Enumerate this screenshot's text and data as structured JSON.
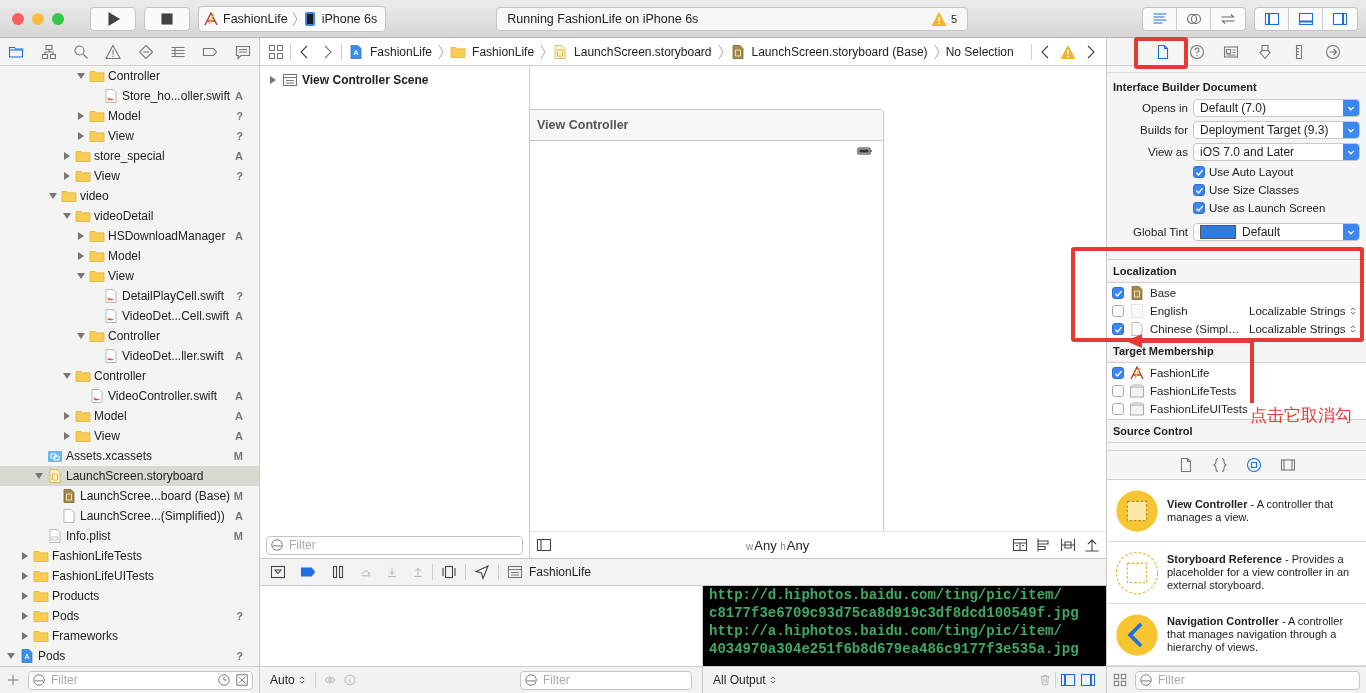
{
  "toolbar": {
    "scheme": "FashionLife",
    "device": "iPhone 6s",
    "activity": "Running FashionLife on iPhone 6s",
    "warnings": "5",
    "editor_modes": [
      {
        "kind": "standard",
        "selected": true
      },
      {
        "kind": "assistant",
        "selected": false
      },
      {
        "kind": "version",
        "selected": false
      }
    ],
    "panels": [
      {
        "kind": "panel_left",
        "on": true
      },
      {
        "kind": "panel_bottom",
        "on": true
      },
      {
        "kind": "panel_right",
        "on": true
      }
    ]
  },
  "navigator": {
    "tabs": [
      {
        "kind": "nav_folder",
        "selected": true
      },
      {
        "kind": "hierarchy",
        "selected": false
      },
      {
        "kind": "search",
        "selected": false
      },
      {
        "kind": "warning",
        "selected": false
      },
      {
        "kind": "diamond",
        "selected": false
      },
      {
        "kind": "list",
        "selected": false
      },
      {
        "kind": "tag",
        "selected": false
      },
      {
        "kind": "chat",
        "selected": false
      }
    ],
    "tree": [
      {
        "children": [
          {
            "children": [
              {
                "children": [
                  {
                    "children": [
                      {
                        "children": [
                          {
                            "label": "Controller",
                            "kind": "folder",
                            "expanded": true,
                            "selected": false,
                            "children": [
                              {
                                "label": "Store_ho...oller.swift",
                                "kind": "swift",
                                "selected": false,
                                "status": "A"
                              }
                            ]
                          },
                          {
                            "label": "Model",
                            "kind": "folder",
                            "expanded": false,
                            "selected": false,
                            "status": "?"
                          },
                          {
                            "label": "View",
                            "kind": "folder",
                            "expanded": false,
                            "selected": false,
                            "status": "?"
                          }
                        ]
                      },
                      {
                        "label": "store_special",
                        "kind": "folder",
                        "expanded": false,
                        "selected": false,
                        "status": "A"
                      },
                      {
                        "label": "View",
                        "kind": "folder",
                        "expanded": false,
                        "selected": false,
                        "status": "?"
                      }
                    ]
                  },
                  {
                    "label": "video",
                    "kind": "folder",
                    "expanded": true,
                    "selected": false,
                    "children": [
                      {
                        "label": "videoDetail",
                        "kind": "folder",
                        "expanded": true,
                        "selected": false,
                        "children": [
                          {
                            "label": "HSDownloadManager",
                            "kind": "folder",
                            "expanded": false,
                            "selected": false,
                            "status": "A"
                          },
                          {
                            "label": "Model",
                            "kind": "folder",
                            "expanded": false,
                            "selected": false
                          },
                          {
                            "label": "View",
                            "kind": "folder",
                            "expanded": true,
                            "selected": false,
                            "children": [
                              {
                                "label": "DetailPlayCell.swift",
                                "kind": "swift",
                                "selected": false,
                                "status": "?"
                              },
                              {
                                "label": "VideoDet...Cell.swift",
                                "kind": "swift",
                                "selected": false,
                                "status": "A"
                              }
                            ]
                          },
                          {
                            "label": "Controller",
                            "kind": "folder",
                            "expanded": true,
                            "selected": false,
                            "children": [
                              {
                                "label": "VideoDet...ller.swift",
                                "kind": "swift",
                                "selected": false,
                                "status": "A"
                              }
                            ]
                          }
                        ]
                      },
                      {
                        "label": "Controller",
                        "kind": "folder",
                        "expanded": true,
                        "selected": false,
                        "children": [
                          {
                            "label": "VideoController.swift",
                            "kind": "swift",
                            "selected": false,
                            "status": "A"
                          }
                        ]
                      },
                      {
                        "label": "Model",
                        "kind": "folder",
                        "expanded": false,
                        "selected": false,
                        "status": "A"
                      },
                      {
                        "label": "View",
                        "kind": "folder",
                        "expanded": false,
                        "selected": false,
                        "status": "A"
                      }
                    ]
                  }
                ]
              },
              {
                "label": "Assets.xcassets",
                "kind": "assets",
                "selected": false,
                "status": "M"
              },
              {
                "label": "LaunchScreen.storyboard",
                "kind": "storyboard",
                "expanded": true,
                "selected": true,
                "children": [
                  {
                    "label": "LaunchScree...board (Base)",
                    "kind": "storyboard_base",
                    "selected": false,
                    "status": "M"
                  },
                  {
                    "label": "LaunchScree...(Simplified))",
                    "kind": "strings",
                    "selected": false,
                    "status": "A"
                  }
                ]
              },
              {
                "label": "Info.plist",
                "kind": "plist",
                "selected": false,
                "status": "M"
              }
            ]
          },
          {
            "label": "FashionLifeTests",
            "kind": "folder",
            "expanded": false,
            "selected": false
          },
          {
            "label": "FashionLifeUITests",
            "kind": "folder",
            "expanded": false,
            "selected": false
          },
          {
            "label": "Products",
            "kind": "folder",
            "expanded": false,
            "selected": false
          },
          {
            "label": "Pods",
            "kind": "folder",
            "expanded": false,
            "selected": false,
            "status": "?"
          },
          {
            "label": "Frameworks",
            "kind": "folder",
            "expanded": false,
            "selected": false
          }
        ]
      },
      {
        "label": "Pods",
        "kind": "project",
        "expanded": true,
        "selected": false,
        "status": "?"
      }
    ],
    "filter": {
      "placeholder": "Filter"
    }
  },
  "jump_bar": {
    "crumbs": [
      {
        "label": "FashionLife",
        "kind": "project"
      },
      {
        "label": "FashionLife",
        "kind": "folder"
      },
      {
        "label": "LaunchScreen.storyboard",
        "kind": "storyboard"
      },
      {
        "label": "LaunchScreen.storyboard (Base)",
        "kind": "storyboard_base"
      },
      {
        "label": "No Selection"
      }
    ]
  },
  "outline": {
    "scenes": [
      {
        "label": "View Controller Scene",
        "expanded": false
      }
    ],
    "filter": {
      "placeholder": "Filter"
    }
  },
  "canvas": {
    "scene_title": "View Controller",
    "size_class": {
      "w_prefix": "w",
      "w": "Any",
      "h_prefix": "h",
      "h": "Any"
    }
  },
  "debug_bar": {
    "process": "FashionLife"
  },
  "variables": {
    "scope": "Auto",
    "filter": {
      "placeholder": "Filter"
    }
  },
  "console": {
    "lines": [
      "http://d.hiphotos.baidu.com/ting/pic/item/",
      "c8177f3e6709c93d75ca8d919c3df8dcd100549f.jpg",
      "http://a.hiphotos.baidu.com/ting/pic/item/",
      "4034970a304e251f6b8d679ea486c9177f3e535a.jpg"
    ],
    "output": "All Output"
  },
  "inspector": {
    "tabs": [
      {
        "kind": "file",
        "selected": true
      },
      {
        "kind": "help",
        "selected": false
      },
      {
        "kind": "identity",
        "selected": false
      },
      {
        "kind": "attributes",
        "selected": false
      },
      {
        "kind": "size",
        "selected": false
      },
      {
        "kind": "connections",
        "selected": false
      }
    ],
    "document": {
      "title": "Interface Builder Document",
      "fields": [
        {
          "label": "Opens in",
          "value": "Default (7.0)"
        },
        {
          "label": "Builds for",
          "value": "Deployment Target (9.3)"
        },
        {
          "label": "View as",
          "value": "iOS 7.0 and Later"
        }
      ],
      "options": [
        {
          "label": "Use Auto Layout",
          "checked": true
        },
        {
          "label": "Use Size Classes",
          "checked": true
        },
        {
          "label": "Use as Launch Screen",
          "checked": true
        }
      ],
      "global_tint": {
        "label": "Global Tint",
        "color": "#2f7de1",
        "value": "Default"
      }
    },
    "localization": {
      "title": "Localization",
      "items": [
        {
          "label": "Base",
          "kind": "storyboard_base",
          "checked": true
        },
        {
          "label": "English",
          "kind": "empty",
          "checked": false,
          "type": "Localizable Strings"
        },
        {
          "label": "Chinese (Simpl…",
          "kind": "strings",
          "checked": true,
          "type": "Localizable Strings"
        }
      ]
    },
    "target_membership": {
      "title": "Target Membership",
      "items": [
        {
          "label": "FashionLife",
          "kind": "app",
          "checked": true
        },
        {
          "label": "FashionLifeTests",
          "kind": "bundle",
          "checked": false
        },
        {
          "label": "FashionLifeUITests",
          "kind": "bundle",
          "checked": false
        }
      ]
    },
    "source_control": {
      "title": "Source Control"
    }
  },
  "library": {
    "tabs": [
      {
        "kind": "file",
        "selected": false
      },
      {
        "kind": "braces",
        "selected": false
      },
      {
        "kind": "object",
        "selected": true
      },
      {
        "kind": "media",
        "selected": false
      }
    ],
    "items": [
      {
        "kind": "view_controller",
        "text": "**View Controller** - A controller that manages a view."
      },
      {
        "kind": "storyboard_reference",
        "text": "**Storyboard Reference** - Provides a placeholder for a view controller in an external storyboard."
      },
      {
        "kind": "navigation_controller",
        "text": "**Navigation Controller** - A controller that manages navigation through a hierarchy of views."
      }
    ],
    "filter": {
      "placeholder": "Filter"
    }
  },
  "annotation": {
    "label": "点击它取消勾"
  }
}
